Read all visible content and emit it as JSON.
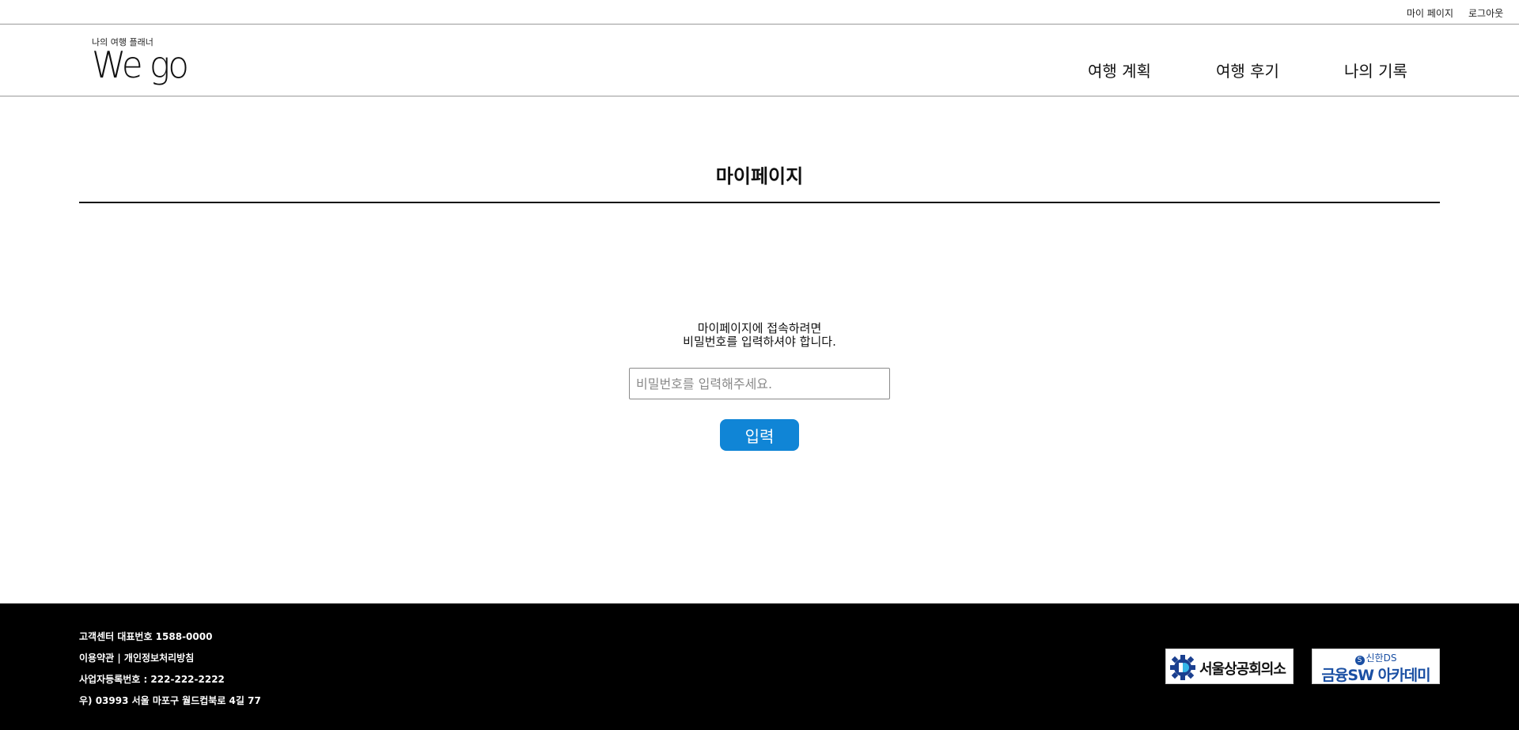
{
  "topbar": {
    "mypage_label": "마이 페이지",
    "logout_label": "로그아웃"
  },
  "header": {
    "logo_tagline": "나의 여행 플래너",
    "logo_wordmark": "We go",
    "nav": [
      {
        "label": "여행 계획"
      },
      {
        "label": "여행 후기"
      },
      {
        "label": "나의 기록"
      }
    ]
  },
  "main": {
    "title": "마이페이지",
    "notice_line1": "마이페이지에 접속하려면",
    "notice_line2": "비밀번호를 입력하셔야 합니다.",
    "password": {
      "value": "",
      "placeholder": "비밀번호를 입력해주세요."
    },
    "submit_label": "입력",
    "accent_color": "#1085d6"
  },
  "footer": {
    "customer_center": "고객센터 대표번호 1588-0000",
    "terms_label": "이용약관",
    "separator": " | ",
    "privacy_label": "개인정보처리방침",
    "business_number": "사업자등록번호 : 222-222-2222",
    "address": "우) 03993 서울 마포구 월드컵북로 4길 77",
    "partners": [
      {
        "name": "서울상공회의소",
        "icon": "gear-logo-icon"
      },
      {
        "top": "신한DS",
        "main": "금융SW 아카데미",
        "icon": "shinhan-logo-icon",
        "color": "#1a4fa3"
      }
    ]
  }
}
